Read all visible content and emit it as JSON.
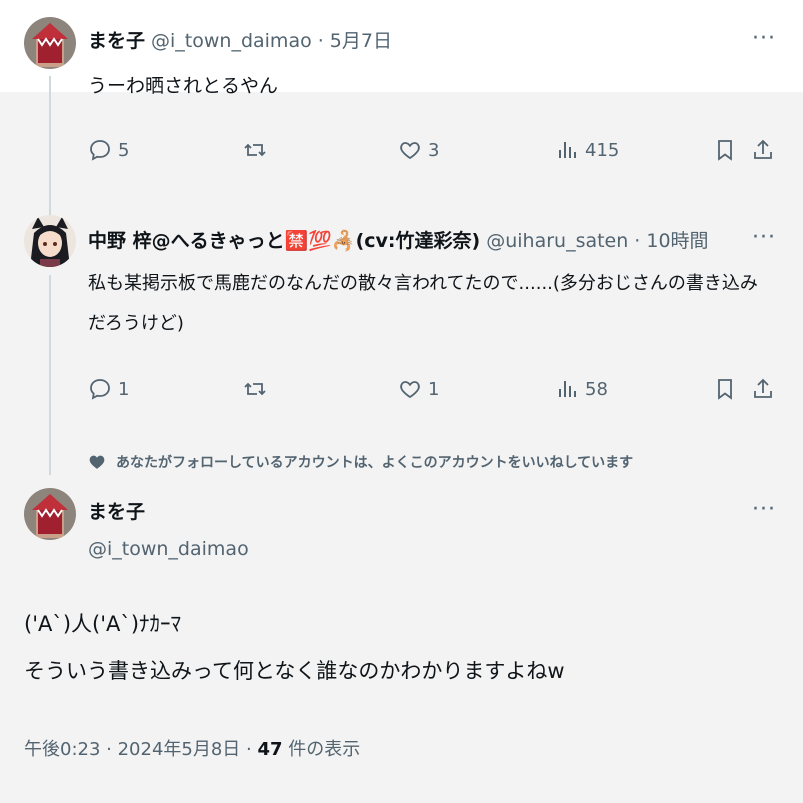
{
  "tweets": [
    {
      "name": "まを子",
      "handle": "@i_town_daimao",
      "time": "· 5月7日",
      "text": "うーわ晒されとるやん",
      "replies": "5",
      "likes": "3",
      "views": "415"
    },
    {
      "name": "中野 梓@へるきゃっと🈲💯🦂(cv:竹達彩奈)",
      "handle": "@uiharu_saten",
      "time": "· 10時間",
      "text_line1": "私も某掲示板で馬鹿だのなんだの散々言われてたので......(多分おじさんの書き込み",
      "text_line2": "だろうけど)",
      "replies": "1",
      "likes": "1",
      "views": "58"
    }
  ],
  "liked_note": "あなたがフォローしているアカウントは、よくこのアカウントをいいねしています",
  "main_tweet": {
    "name": "まを子",
    "handle": "@i_town_daimao",
    "line1": "('A`)人('A`)ﾅｶｰﾏ",
    "line2": "そういう書き込みって何となく誰なのかわかりますよねw",
    "timestamp": "午後0:23 · 2024年5月8日 · ",
    "view_count": "47",
    "view_label": " 件の表示"
  },
  "more_label": "···",
  "icons": [
    "reply-icon",
    "retweet-icon",
    "like-icon",
    "views-icon",
    "bookmark-icon",
    "share-icon",
    "heart-filled-icon",
    "more-icon"
  ]
}
